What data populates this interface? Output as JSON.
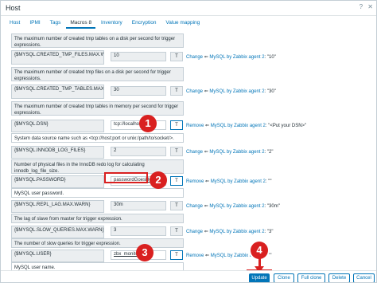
{
  "window": {
    "title": "Host",
    "help_icon": "help-icon",
    "close_icon": "close-icon"
  },
  "tabs": [
    {
      "label": "Host"
    },
    {
      "label": "IPMI"
    },
    {
      "label": "Tags"
    },
    {
      "label": "Macros 8"
    },
    {
      "label": "Inventory"
    },
    {
      "label": "Encryption"
    },
    {
      "label": "Value mapping"
    }
  ],
  "rows": {
    "r1_desc": "The maximum number of created tmp tables on a disk per second for trigger expressions.",
    "r1_macro": "{$MYSQL.CREATED_TMP_FILES.MAX.WARN}",
    "r1_value": "10",
    "r1_type": "T",
    "r1_action": "Change",
    "r1_inh_text": "⇐ ",
    "r1_inh_link": "MySQL by Zabbix agent 2",
    "r1_inh_val": ": \"10\"",
    "r2_desc": "The maximum number of created tmp files on a disk per second for trigger expressions.",
    "r2_macro": "{$MYSQL.CREATED_TMP_TABLES.MAX.WARN}",
    "r2_value": "30",
    "r2_type": "T",
    "r2_action": "Change",
    "r2_inh_text": "⇐ ",
    "r2_inh_link": "MySQL by Zabbix agent 2",
    "r2_inh_val": ": \"30\"",
    "r3_desc": "The maximum number of created tmp tables in memory per second for trigger expressions.",
    "r3_macro": "{$MYSQL.DSN}",
    "r3_value": "tcp://localhost",
    "r3_type": "T",
    "r3_action": "Remove",
    "r3_inh_text": "⇐ ",
    "r3_inh_link": "MySQL by Zabbix agent 2",
    "r3_inh_val": ": \"<Put your DSN>\"",
    "r3_note": "System data source name such as <tcp://host:port or unix:/path/to/socket/>.",
    "r4_macro": "{$MYSQL.INNODB_LOG_FILES}",
    "r4_value": "2",
    "r4_type": "T",
    "r4_action": "Change",
    "r4_inh_text": "⇐ ",
    "r4_inh_link": "MySQL by Zabbix agent 2",
    "r4_inh_val": ": \"2\"",
    "r4_desc": "Number of physical files in the InnoDB redo log for calculating innodb_log_file_size.",
    "r5_macro": "{$MYSQL.PASSWORD}",
    "r5_value": "passwordGoesHere",
    "r5_type": "T",
    "r5_action": "Remove",
    "r5_inh_text": "⇐ ",
    "r5_inh_link": "MySQL by Zabbix agent 2",
    "r5_inh_val": ": \"\"",
    "r5_note": "MySQL user password.",
    "r6_macro": "{$MYSQL.REPL_LAG.MAX.WARN}",
    "r6_value": "30m",
    "r6_type": "T",
    "r6_action": "Change",
    "r6_inh_text": "⇐ ",
    "r6_inh_link": "MySQL by Zabbix agent 2",
    "r6_inh_val": ": \"30m\"",
    "r6_desc": "The lag of slave from master for trigger expression.",
    "r7_macro": "{$MYSQL.SLOW_QUERIES.MAX.WARN}",
    "r7_value": "3",
    "r7_type": "T",
    "r7_action": "Change",
    "r7_inh_text": "⇐ ",
    "r7_inh_link": "MySQL by Zabbix agent 2",
    "r7_inh_val": ": \"3\"",
    "r7_desc": "The number of slow queries for trigger expression.",
    "r8_macro": "{$MYSQL.USER}",
    "r8_value": "zbx_monitor",
    "r8_type": "T",
    "r8_action": "Remove",
    "r8_inh_text": "⇐ ",
    "r8_inh_link": "MySQL by Zabbix agent 2",
    "r8_inh_val": ": \"\"",
    "r8_note": "MySQL user name."
  },
  "markers": {
    "m1": "1",
    "m2": "2",
    "m3": "3",
    "m4": "4"
  },
  "footer": {
    "update": "Update",
    "clone": "Clone",
    "full_clone": "Full clone",
    "delete": "Delete",
    "cancel": "Cancel"
  },
  "colors": {
    "accent": "#0275b8",
    "marker": "#d92020"
  }
}
